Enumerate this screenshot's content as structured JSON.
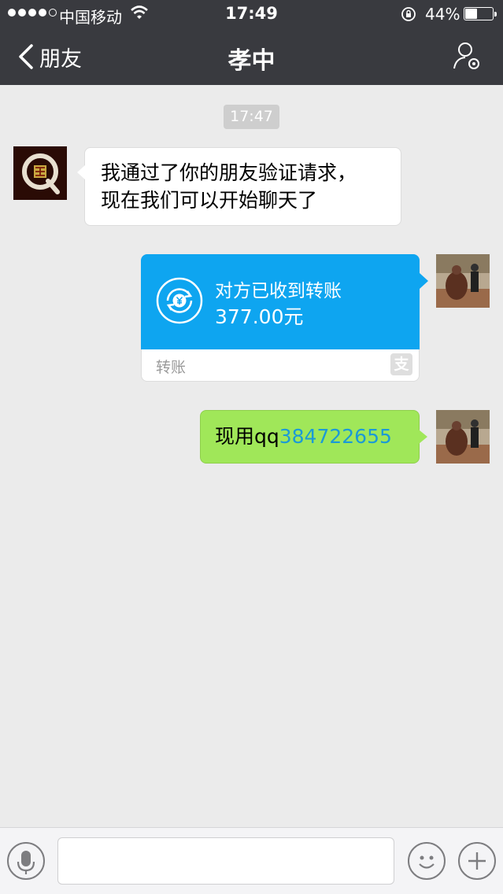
{
  "status_bar": {
    "carrier": "中国移动",
    "time": "17:49",
    "battery_pct": "44%",
    "battery_level": 0.44,
    "signal_bars_filled": 4,
    "signal_bars_total": 5
  },
  "nav": {
    "back_label": "朋友",
    "title": "孝中"
  },
  "chat": {
    "timestamp": "17:47",
    "messages": [
      {
        "type": "text",
        "direction": "incoming",
        "lines": [
          "我通过了你的朋友验证请求，",
          "现在我们可以开始聊天了"
        ]
      },
      {
        "type": "transfer",
        "direction": "outgoing",
        "title": "对方已收到转账",
        "amount": "377.00元",
        "footer": "转账"
      },
      {
        "type": "text",
        "direction": "outgoing",
        "prefix": "现用qq",
        "link": "384722655"
      }
    ]
  },
  "colors": {
    "nav_bg": "#393a3f",
    "chat_bg": "#ebebeb",
    "transfer_blue": "#0ea5f0",
    "outgoing_green": "#a0e759",
    "link_blue": "#1b9ad6"
  },
  "icons": {
    "back": "chevron-left-icon",
    "profile": "user-settings-icon",
    "coin": "yen-exchange-icon",
    "alipay": "alipay-icon",
    "voice": "microphone-icon",
    "emoji": "smiley-icon",
    "plus": "plus-icon"
  }
}
